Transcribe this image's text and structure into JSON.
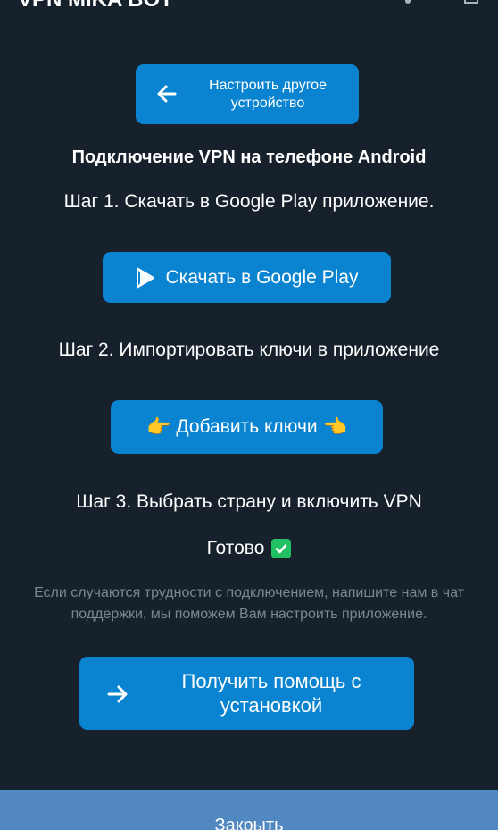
{
  "header": {
    "title": "VPN MIKA BOT",
    "menu_icon": "more-vertical-icon",
    "corner_icon": "expand-icon"
  },
  "back_button": {
    "label": "Настроить другое устройство",
    "icon": "arrow-left-icon"
  },
  "heading": "Подключение VPN на телефоне Android",
  "step1": {
    "text": "Шаг 1. Скачать в Google Play приложение.",
    "button_label": "Скачать в Google Play",
    "icon": "google-play-icon"
  },
  "step2": {
    "text": "Шаг 2. Импортировать ключи в приложение",
    "button_label": "Добавить ключи",
    "left_emoji": "👉",
    "right_emoji": "👈"
  },
  "step3": {
    "text": "Шаг 3. Выбрать страну и включить VPN"
  },
  "done": {
    "label": "Готово",
    "icon": "check-mark-icon"
  },
  "note": "Если случаются трудности с подключением, напишите нам в чат поддержки, мы поможем Вам настроить приложение.",
  "help_button": {
    "label": "Получить помощь с установкой",
    "icon": "arrow-right-icon"
  },
  "close_button": {
    "label": "Закрыть"
  },
  "colors": {
    "background": "#17212b",
    "button": "#0a84d0",
    "bottom_bar": "#5288c1",
    "note_text": "#7d8791",
    "check": "#21c063"
  }
}
